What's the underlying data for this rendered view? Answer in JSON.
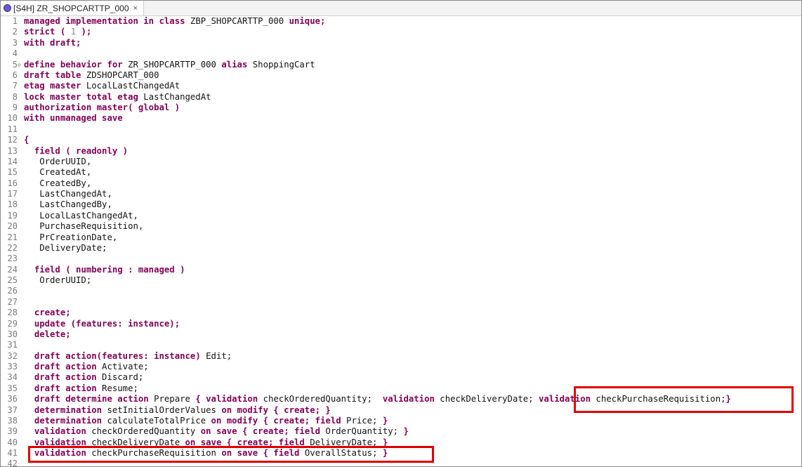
{
  "tab": {
    "title": "[S4H] ZR_SHOPCARTTP_000",
    "close_glyph": "×"
  },
  "lines": [
    [
      [
        "kw",
        "managed implementation in class"
      ],
      [
        "t",
        " ZBP_SHOPCARTTP_000 "
      ],
      [
        "kw",
        "unique;"
      ]
    ],
    [
      [
        "kw",
        "strict ( "
      ],
      [
        "num",
        "1"
      ],
      [
        "kw",
        " );"
      ]
    ],
    [
      [
        "kw",
        "with draft;"
      ]
    ],
    [],
    [
      [
        "kw",
        "define behavior for"
      ],
      [
        "t",
        " ZR_SHOPCARTTP_000 "
      ],
      [
        "kw",
        "alias"
      ],
      [
        "t",
        " ShoppingCart"
      ]
    ],
    [
      [
        "kw",
        "draft table"
      ],
      [
        "t",
        " ZDSHOPCART_000"
      ]
    ],
    [
      [
        "kw",
        "etag master"
      ],
      [
        "t",
        " LocalLastChangedAt"
      ]
    ],
    [
      [
        "kw",
        "lock master total etag"
      ],
      [
        "t",
        " LastChangedAt"
      ]
    ],
    [
      [
        "kw",
        "authorization master( global )"
      ]
    ],
    [
      [
        "kw",
        "with unmanaged save"
      ]
    ],
    [],
    [
      [
        "kw",
        "{"
      ]
    ],
    [
      [
        "t",
        "  "
      ],
      [
        "kw",
        "field ( readonly )"
      ]
    ],
    [
      [
        "t",
        "   OrderUUID,"
      ]
    ],
    [
      [
        "t",
        "   CreatedAt,"
      ]
    ],
    [
      [
        "t",
        "   CreatedBy,"
      ]
    ],
    [
      [
        "t",
        "   LastChangedAt,"
      ]
    ],
    [
      [
        "t",
        "   LastChangedBy,"
      ]
    ],
    [
      [
        "t",
        "   LocalLastChangedAt,"
      ]
    ],
    [
      [
        "t",
        "   PurchaseRequisition,"
      ]
    ],
    [
      [
        "t",
        "   PrCreationDate,"
      ]
    ],
    [
      [
        "t",
        "   DeliveryDate;"
      ]
    ],
    [],
    [
      [
        "t",
        "  "
      ],
      [
        "kw",
        "field ( numbering : managed )"
      ]
    ],
    [
      [
        "t",
        "   OrderUUID;"
      ]
    ],
    [],
    [],
    [
      [
        "t",
        "  "
      ],
      [
        "kw",
        "create;"
      ]
    ],
    [
      [
        "t",
        "  "
      ],
      [
        "kw",
        "update (features: instance);"
      ]
    ],
    [
      [
        "t",
        "  "
      ],
      [
        "kw",
        "delete;"
      ]
    ],
    [],
    [
      [
        "t",
        "  "
      ],
      [
        "kw",
        "draft action(features: instance)"
      ],
      [
        "t",
        " Edit;"
      ]
    ],
    [
      [
        "t",
        "  "
      ],
      [
        "kw",
        "draft action"
      ],
      [
        "t",
        " Activate;"
      ]
    ],
    [
      [
        "t",
        "  "
      ],
      [
        "kw",
        "draft action"
      ],
      [
        "t",
        " Discard;"
      ]
    ],
    [
      [
        "t",
        "  "
      ],
      [
        "kw",
        "draft action"
      ],
      [
        "t",
        " Resume;"
      ]
    ],
    [
      [
        "t",
        "  "
      ],
      [
        "kw",
        "draft determine action"
      ],
      [
        "t",
        " Prepare "
      ],
      [
        "kw",
        "{ validation"
      ],
      [
        "t",
        " checkOrderedQuantity;  "
      ],
      [
        "kw",
        "validation"
      ],
      [
        "t",
        " checkDeliveryDate; "
      ],
      [
        "kw",
        "validation"
      ],
      [
        "t",
        " checkPurchaseRequisition;"
      ],
      [
        "kw",
        "}"
      ]
    ],
    [
      [
        "t",
        "  "
      ],
      [
        "kw",
        "determination"
      ],
      [
        "t",
        " setInitialOrderValues "
      ],
      [
        "kw",
        "on modify { create; }"
      ]
    ],
    [
      [
        "t",
        "  "
      ],
      [
        "kw",
        "determination"
      ],
      [
        "t",
        " calculateTotalPrice "
      ],
      [
        "kw",
        "on modify { create; field"
      ],
      [
        "t",
        " Price; "
      ],
      [
        "kw",
        "}"
      ]
    ],
    [
      [
        "t",
        "  "
      ],
      [
        "kw",
        "validation"
      ],
      [
        "t",
        " checkOrderedQuantity "
      ],
      [
        "kw",
        "on save { create; field"
      ],
      [
        "t",
        " OrderQuantity; "
      ],
      [
        "kw",
        "}"
      ]
    ],
    [
      [
        "t",
        "  "
      ],
      [
        "kw",
        "validation"
      ],
      [
        "t",
        " checkDeliveryDate "
      ],
      [
        "kw",
        "on save { create; field"
      ],
      [
        "t",
        " DeliveryDate; "
      ],
      [
        "kw",
        "}"
      ]
    ],
    [
      [
        "t",
        "  "
      ],
      [
        "kw",
        "validation"
      ],
      [
        "t",
        " checkPurchaseRequisition "
      ],
      [
        "kw",
        "on save { field"
      ],
      [
        "t",
        " OverallStatus; "
      ],
      [
        "kw",
        "}"
      ]
    ],
    []
  ],
  "fold_marker_line": 5,
  "fold_glyph": "⊖",
  "highlight_color": "#e00000"
}
